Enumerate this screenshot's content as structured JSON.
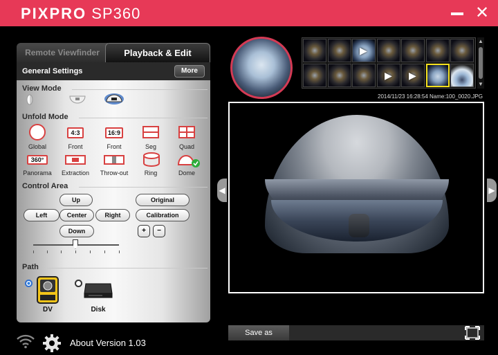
{
  "app": {
    "brand": "PIXPRO",
    "model": "SP360",
    "minimize_label": "—",
    "close_label": "✕"
  },
  "tabs": {
    "remote": "Remote Viewfinder",
    "playback": "Playback & Edit"
  },
  "general": {
    "title": "General Settings",
    "more": "More"
  },
  "view_mode": {
    "title": "View Mode",
    "icons": [
      "front-view-icon",
      "ceiling-view-icon",
      "dome-view-icon"
    ]
  },
  "unfold_mode": {
    "title": "Unfold Mode",
    "items": [
      {
        "label": "Global",
        "box": ""
      },
      {
        "label": "Front",
        "box": "4:3"
      },
      {
        "label": "Front",
        "box": "16:9"
      },
      {
        "label": "Seg",
        "box": ""
      },
      {
        "label": "Quad",
        "box": ""
      },
      {
        "label": "Panorama",
        "box": "360°"
      },
      {
        "label": "Extraction",
        "box": ""
      },
      {
        "label": "Throw-out",
        "box": ""
      },
      {
        "label": "Ring",
        "box": ""
      },
      {
        "label": "Dome",
        "box": ""
      }
    ]
  },
  "control_area": {
    "title": "Control Area",
    "up": "Up",
    "left": "Left",
    "center": "Center",
    "right": "Right",
    "down": "Down",
    "original": "Original",
    "calibration": "Calibration",
    "zoom_in": "+",
    "zoom_out": "−",
    "slider_value": 0.5
  },
  "path": {
    "title": "Path",
    "dv": "DV",
    "disk": "Disk",
    "selected": "DV"
  },
  "about": "About Version 1.03",
  "file_info": "2014/11/23 16:28:54 Name:100_0020.JPG",
  "save_as": "Save as",
  "colors": {
    "accent": "#e73957",
    "selection": "#f5e11e",
    "radio": "#2d7fe0"
  }
}
